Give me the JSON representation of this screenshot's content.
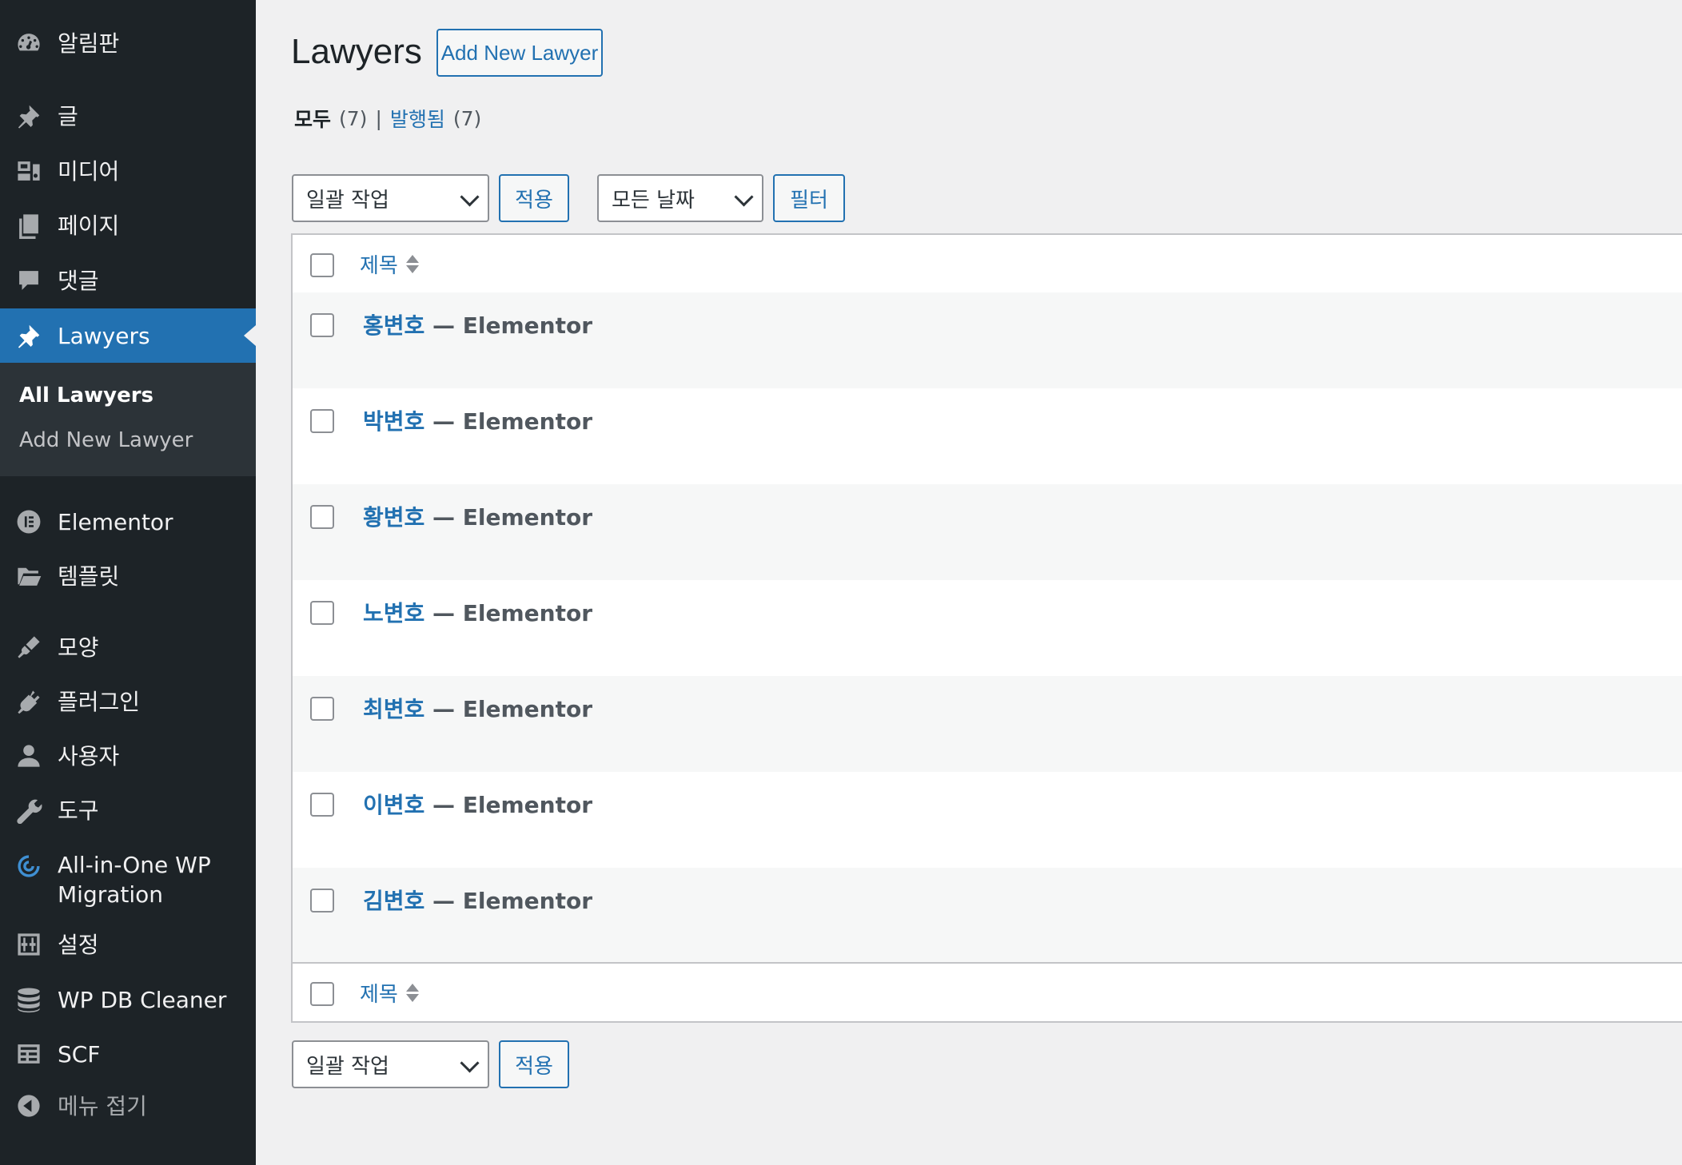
{
  "sidebar": {
    "items": [
      {
        "id": "dashboard",
        "label": "알림판",
        "icon": "dashboard-icon"
      },
      {
        "id": "posts",
        "label": "글",
        "icon": "pin-icon"
      },
      {
        "id": "media",
        "label": "미디어",
        "icon": "media-icon"
      },
      {
        "id": "pages",
        "label": "페이지",
        "icon": "page-icon"
      },
      {
        "id": "comments",
        "label": "댓글",
        "icon": "comment-icon"
      },
      {
        "id": "lawyers",
        "label": "Lawyers",
        "icon": "pin-icon",
        "current": true
      },
      {
        "id": "elementor",
        "label": "Elementor",
        "icon": "elementor-icon"
      },
      {
        "id": "templates",
        "label": "템플릿",
        "icon": "folder-icon"
      },
      {
        "id": "appearance",
        "label": "모양",
        "icon": "brush-icon"
      },
      {
        "id": "plugins",
        "label": "플러그인",
        "icon": "plugin-icon"
      },
      {
        "id": "users",
        "label": "사용자",
        "icon": "user-icon"
      },
      {
        "id": "tools",
        "label": "도구",
        "icon": "wrench-icon"
      },
      {
        "id": "aio-migration",
        "label_line1": "All-in-One WP",
        "label_line2": "Migration",
        "icon": "migration-icon"
      },
      {
        "id": "settings",
        "label": "설정",
        "icon": "sliders-icon"
      },
      {
        "id": "wp-db-cleaner",
        "label": "WP DB Cleaner",
        "icon": "database-icon"
      },
      {
        "id": "scf",
        "label": "SCF",
        "icon": "table-icon"
      },
      {
        "id": "collapse",
        "label": "메뉴 접기",
        "icon": "collapse-icon"
      }
    ],
    "submenu": {
      "all": "All Lawyers",
      "add_new": "Add New Lawyer"
    }
  },
  "header": {
    "title": "Lawyers",
    "add_new_label": "Add New Lawyer"
  },
  "views": {
    "all_label": "모두",
    "all_count": "(7)",
    "separator": "|",
    "published_label": "발행됨",
    "published_count": "(7)"
  },
  "tablenav": {
    "bulk_actions": "일괄 작업",
    "apply": "적용",
    "date_filter": "모든 날짜",
    "filter": "필터"
  },
  "table": {
    "column_title": "제목",
    "rows": [
      {
        "name": "홍변호",
        "suffix": " — Elementor"
      },
      {
        "name": "박변호",
        "suffix": " — Elementor"
      },
      {
        "name": "황변호",
        "suffix": " — Elementor"
      },
      {
        "name": "노변호",
        "suffix": " — Elementor"
      },
      {
        "name": "최변호",
        "suffix": " — Elementor"
      },
      {
        "name": "이변호",
        "suffix": " — Elementor"
      },
      {
        "name": "김변호",
        "suffix": " — Elementor"
      }
    ]
  },
  "colors": {
    "sidebar_bg": "#1d2327",
    "accent": "#2271b1",
    "submenu_bg": "#2c3338",
    "page_bg": "#f0f0f1"
  }
}
